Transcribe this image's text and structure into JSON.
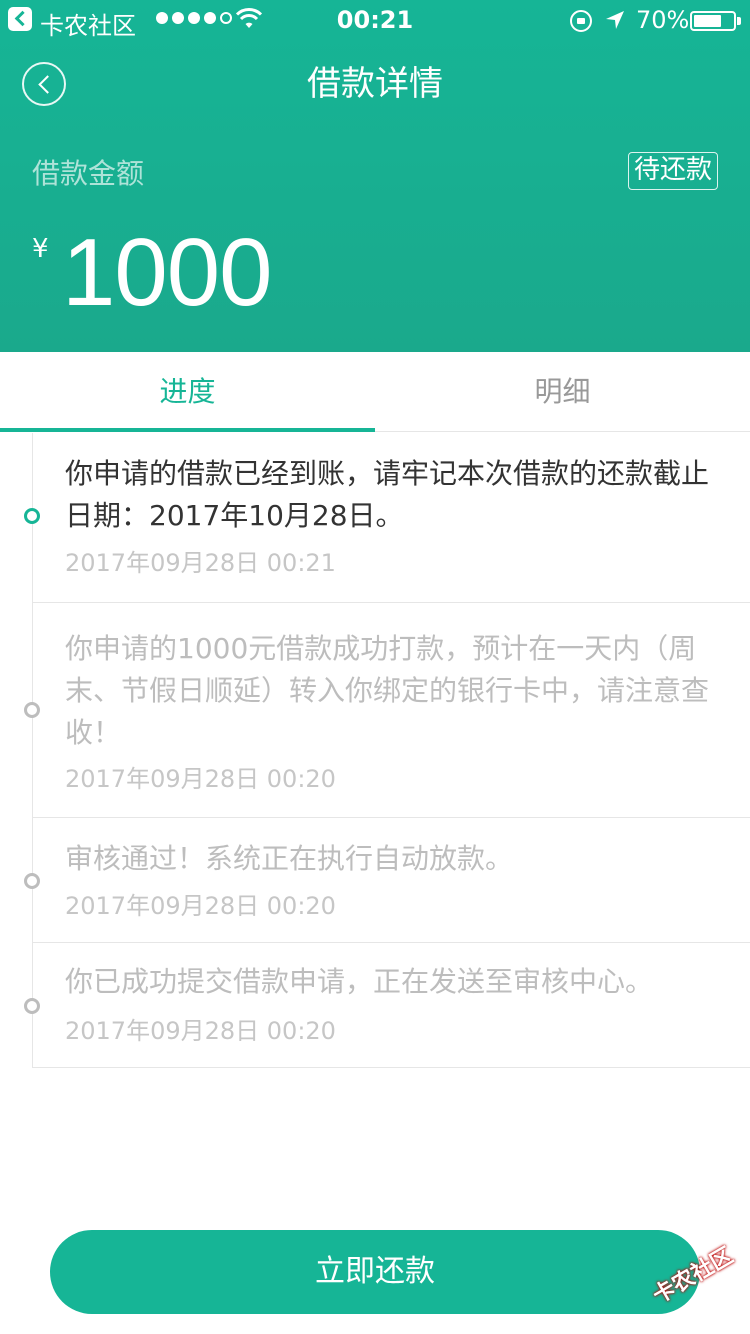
{
  "status_bar": {
    "app_name": "卡农社区",
    "time": "00:21",
    "battery_text": "70%",
    "battery_level": 0.7,
    "signal_dots": 4,
    "icons": [
      "back-app-icon",
      "wifi-icon",
      "rotation-lock-icon",
      "location-icon",
      "battery-icon"
    ]
  },
  "nav": {
    "title": "借款详情",
    "back_icon": "back-chevron-icon"
  },
  "loan": {
    "amount_label": "借款金额",
    "status": "待还款",
    "currency": "¥",
    "amount": "1000"
  },
  "tabs": [
    {
      "label": "进度",
      "active": true
    },
    {
      "label": "明细",
      "active": false
    }
  ],
  "timeline": [
    {
      "text": "你申请的借款已经到账，请牢记本次借款的还款截止日期：2017年10月28日。",
      "time": "2017年09月28日 00:21",
      "active": true
    },
    {
      "text": "你申请的1000元借款成功打款，预计在一天内（周末、节假日顺延）转入你绑定的银行卡中，请注意查收！",
      "time": "2017年09月28日 00:20",
      "active": false
    },
    {
      "text": "审核通过！系统正在执行自动放款。",
      "time": "2017年09月28日 00:20",
      "active": false
    },
    {
      "text": "你已成功提交借款申请，正在发送至审核中心。",
      "time": "2017年09月28日 00:20",
      "active": false
    }
  ],
  "action": {
    "repay_label": "立即还款"
  },
  "watermark": {
    "text": "卡农社区"
  },
  "colors": {
    "accent": "#16b596",
    "inactive_text": "#bdbdbd",
    "active_text": "#333333"
  }
}
